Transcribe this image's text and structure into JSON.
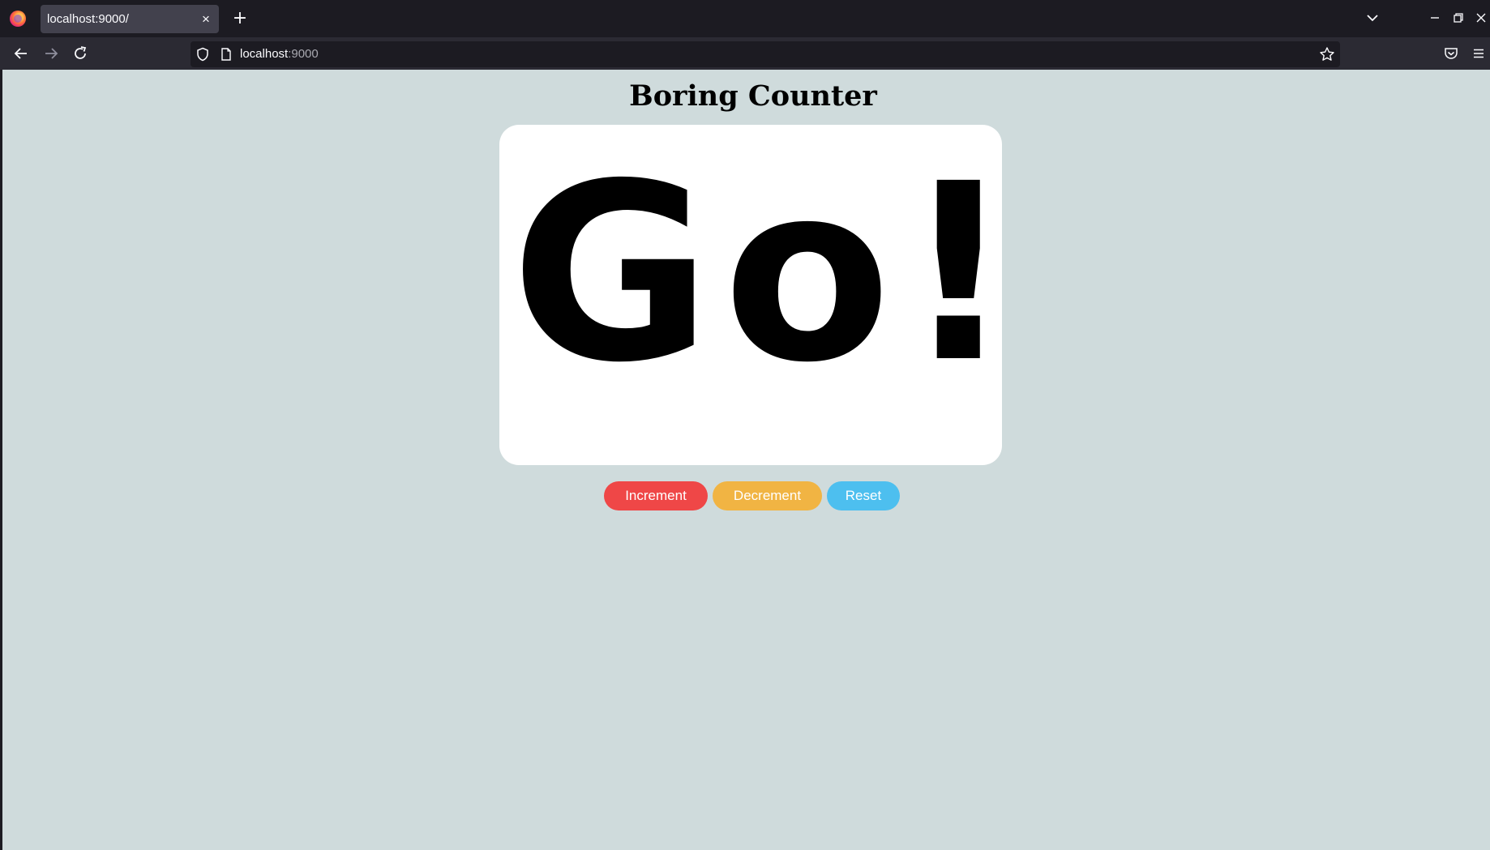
{
  "browser": {
    "tab": {
      "title": "localhost:9000/",
      "close_glyph": "×"
    },
    "new_tab_glyph": "+",
    "url": {
      "host": "localhost",
      "port": ":9000"
    },
    "icons": {
      "logo": "firefox-logo-icon",
      "back": "arrow-left-icon",
      "forward": "arrow-right-icon",
      "reload": "reload-icon",
      "shield": "shield-icon",
      "page": "page-icon",
      "star": "star-icon",
      "pocket": "pocket-icon",
      "menu": "hamburger-menu-icon",
      "list_tabs": "chevron-down-icon",
      "minimize": "minimize-icon",
      "restore": "restore-icon",
      "close": "close-icon"
    }
  },
  "page": {
    "title": "Boring Counter",
    "display": "Go!",
    "buttons": {
      "increment": "Increment",
      "decrement": "Decrement",
      "reset": "Reset"
    },
    "colors": {
      "background": "#cfdbdc",
      "card": "#ffffff",
      "increment": "#ef4747",
      "decrement": "#f1b443",
      "reset": "#4dbfef"
    }
  }
}
